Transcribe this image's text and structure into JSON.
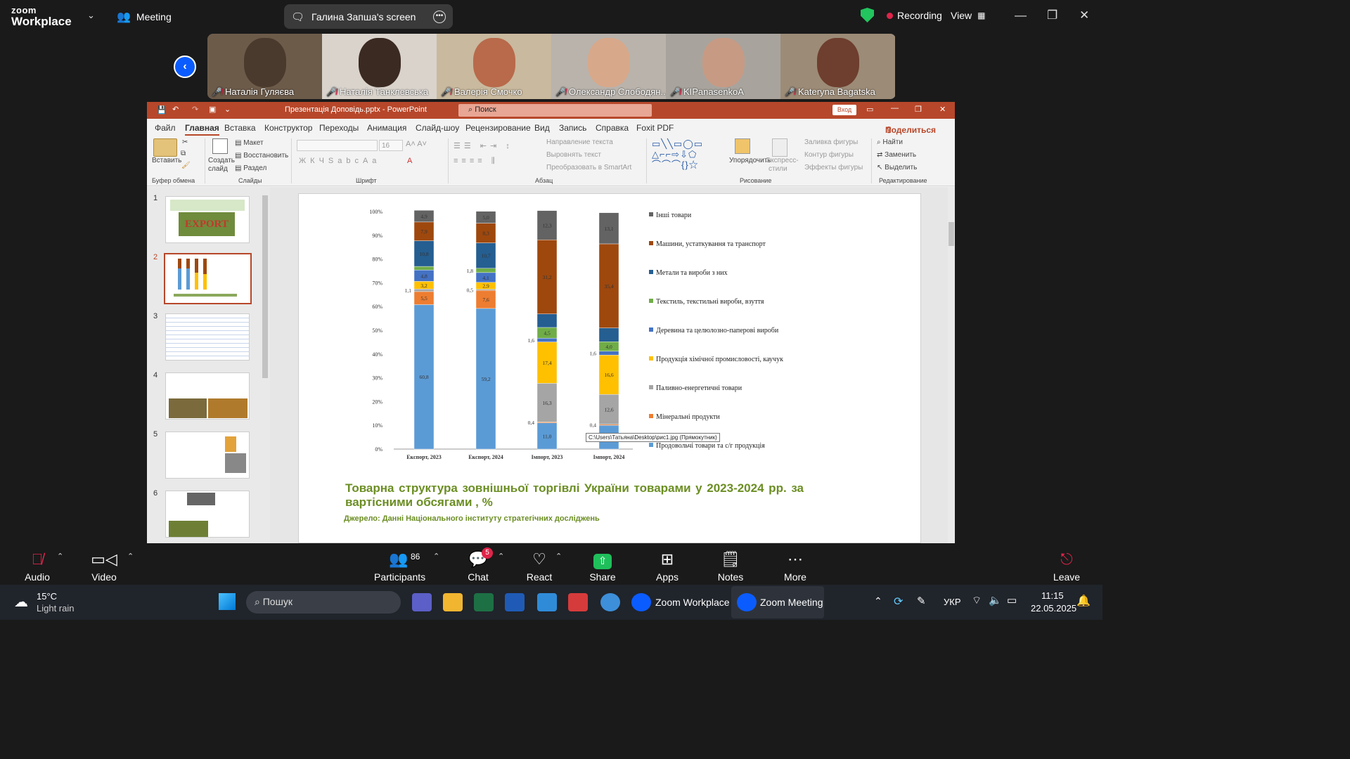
{
  "zoom": {
    "app_name_top": "zoom",
    "app_name_bottom": "Workplace",
    "meeting_label": "Meeting",
    "share_label": "Галина Запша's screen",
    "recording_label": "Recording",
    "view_label": "View",
    "accent": "#0b5cff"
  },
  "participants": [
    {
      "name": "Наталія Гуляєва",
      "bg": "#6d5b4a",
      "head": "#4a3a2e"
    },
    {
      "name": "Наталія Танклевська",
      "bg": "#d9d3cc",
      "head": "#3b2a22"
    },
    {
      "name": "Валерія Смочко",
      "bg": "#c9b99e",
      "head": "#b86a4b"
    },
    {
      "name": "Олександр Слободян...",
      "bg": "#b9b3ac",
      "head": "#d8a88a"
    },
    {
      "name": "KIPanasenkoA",
      "bg": "#a8a49d",
      "head": "#c79a84"
    },
    {
      "name": "Kateryna Bagatska",
      "bg": "#9c8b77",
      "head": "#6e3e2e"
    }
  ],
  "ppt": {
    "title": "Презентація Доповідь.pptx - PowerPoint",
    "search_placeholder": "Поиск",
    "login": "Вход",
    "share": "Поделиться",
    "menu": [
      "Файл",
      "Главная",
      "Вставка",
      "Конструктор",
      "Переходы",
      "Анимация",
      "Слайд-шоу",
      "Рецензирование",
      "Вид",
      "Запись",
      "Справка",
      "Foxit PDF"
    ],
    "ribbon": {
      "paste": "Вставить",
      "clipboard": "Буфер обмена",
      "new_slide_1": "Создать",
      "new_slide_2": "слайд",
      "layout": "Макет",
      "reset": "Восстановить",
      "section": "Раздел",
      "slides": "Слайды",
      "font_size": "16",
      "font": "Шрифт",
      "text_direction": "Направление текста",
      "align_text": "Выровнять текст",
      "smartart": "Преобразовать в SmartArt",
      "paragraph": "Абзац",
      "arrange": "Упорядочить",
      "quick_styles_1": "Экспресс-",
      "quick_styles_2": "стили",
      "shape_fill": "Заливка фигуры",
      "shape_outline": "Контур фигуры",
      "shape_effects": "Эффекты фигуры",
      "drawing": "Рисование",
      "find": "Найти",
      "replace": "Заменить",
      "select": "Выделить",
      "editing": "Редактирование"
    },
    "slide_numbers": [
      "1",
      "2",
      "3",
      "4",
      "5",
      "6"
    ],
    "caption": "Товарна структура зовнішньої торгівлі України товарами у 2023-2024 рр. за вартісними обсягами , %",
    "source": "Джерело: Данні Національного інституту стратегічних досліджень",
    "tooltip": "C:\\Users\\Татьяна\\Desktop\\рис1.jpg (Прямокутник)",
    "accent": "#b7472a"
  },
  "chart_data": {
    "type": "bar",
    "stacked": true,
    "categories": [
      "Експорт, 2023",
      "Експорт, 2024",
      "Імпорт, 2023",
      "Імпорт, 2024"
    ],
    "ylim": [
      0,
      100
    ],
    "yticks": [
      "0%",
      "10%",
      "20%",
      "30%",
      "40%",
      "50%",
      "60%",
      "70%",
      "80%",
      "90%",
      "100%"
    ],
    "series": [
      {
        "name": "Продовольчі товари та с/г продукція",
        "color": "#5b9bd5",
        "values": [
          60.8,
          59.2,
          11.0,
          10.0
        ],
        "labels": [
          "60,8",
          "59,2",
          "11,0",
          ""
        ]
      },
      {
        "name": "Мінеральні продукти",
        "color": "#ed7d31",
        "values": [
          5.5,
          7.6,
          0.4,
          0.4
        ],
        "labels": [
          "5,5",
          "7,6",
          "0,4",
          "0,4"
        ]
      },
      {
        "name": "Паливно-енергетичні товари",
        "color": "#a5a5a5",
        "values": [
          1.1,
          0.5,
          16.3,
          12.6
        ],
        "labels": [
          "1,1",
          "0,5",
          "16,3",
          "12,6"
        ]
      },
      {
        "name": "Продукція хімічної промисловості, каучук",
        "color": "#ffc000",
        "values": [
          3.2,
          2.9,
          17.4,
          16.6
        ],
        "labels": [
          "3,2",
          "2,9",
          "17,4",
          "16,6"
        ]
      },
      {
        "name": "Деревина та целюлозно-паперові вироби",
        "color": "#4472c4",
        "values": [
          4.8,
          4.1,
          1.6,
          1.6
        ],
        "labels": [
          "4,8",
          "4,1",
          "1,6",
          "1,6"
        ]
      },
      {
        "name": "Текстиль, текстильні вироби, взуття",
        "color": "#70ad47",
        "values": [
          1.5,
          1.8,
          4.5,
          4.0
        ],
        "labels": [
          "",
          "1,8",
          "4,5",
          "4,0"
        ]
      },
      {
        "name": "Метали та вироби з них",
        "color": "#255e91",
        "values": [
          10.8,
          10.7,
          5.7,
          5.8
        ],
        "labels": [
          "10,8",
          "10,7",
          "",
          ""
        ]
      },
      {
        "name": "Машини, устаткування та транспорт",
        "color": "#9e480e",
        "values": [
          7.9,
          8.3,
          31.2,
          35.4
        ],
        "labels": [
          "7,9",
          "8,3",
          "31,2",
          "35,4"
        ]
      },
      {
        "name": "Інші товари",
        "color": "#636363",
        "values": [
          4.9,
          5.0,
          12.3,
          13.1
        ],
        "labels": [
          "4,9",
          "5,0",
          "12,3",
          "13,1"
        ]
      }
    ]
  },
  "bottom_bar": {
    "audio": "Audio",
    "video": "Video",
    "participants": "Participants",
    "participants_count": "86",
    "chat": "Chat",
    "chat_badge": "5",
    "react": "React",
    "share": "Share",
    "apps": "Apps",
    "notes": "Notes",
    "more": "More",
    "leave": "Leave"
  },
  "taskbar": {
    "temp": "15°C",
    "weather": "Light rain",
    "search": "Пошук",
    "zoom_workplace": "Zoom Workplace",
    "zoom_meeting": "Zoom Meeting",
    "lang": "УКР",
    "time": "11:15",
    "date": "22.05.2025"
  }
}
